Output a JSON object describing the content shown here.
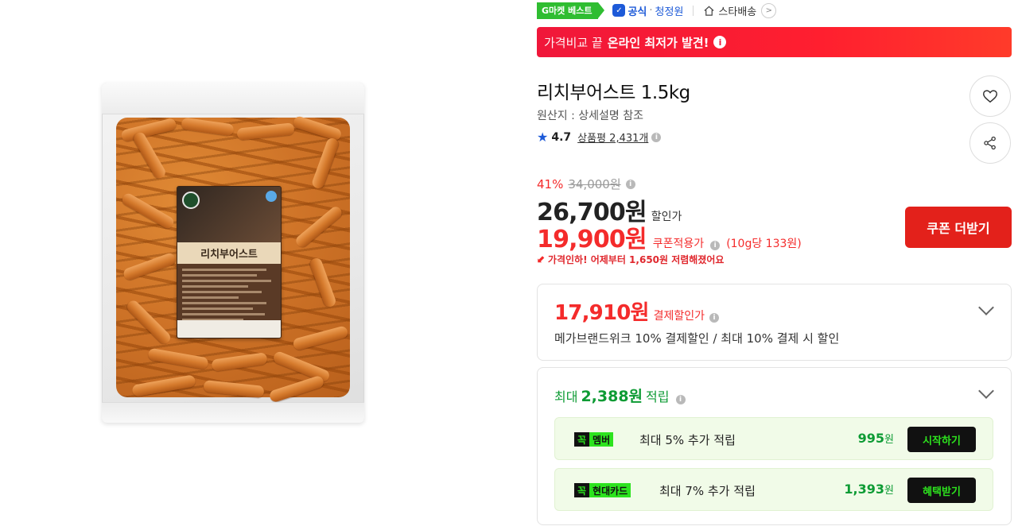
{
  "badges": {
    "gmarket_best": "G마켓 베스트",
    "official": "공식",
    "official_store": "청정원",
    "delivery": "스타배송"
  },
  "promo": {
    "light": "가격비교 끝",
    "strong": "온라인 최저가 발견!",
    "info": "i"
  },
  "product": {
    "title": "리치부어스트 1.5kg",
    "origin": "원산지 : 상세설명 참조",
    "rating": "4.7",
    "review_label": "상품평 2,431개",
    "package_label": "리치부어스트"
  },
  "price": {
    "discount_rate": "41%",
    "original_price": "34,000원",
    "sale_price": "26,700원",
    "sale_label": "할인가",
    "coupon_price": "19,900원",
    "coupon_label": "쿠폰적용가",
    "unit_price": "(10g당 133원)",
    "price_drop_note": "가격인하! 어제부터 1,650원 저렴해졌어요",
    "coupon_button": "쿠폰 더받기"
  },
  "payment": {
    "price": "17,910원",
    "label": "결제할인가",
    "description": "메가브랜드위크 10% 결제할인 / 최대 10% 결제 시 할인"
  },
  "reward": {
    "prefix": "최대",
    "amount": "2,388원",
    "suffix": "적립",
    "items": [
      {
        "tag_dark": "꼭",
        "tag_green": "멤버",
        "text": "최대 5% 추가 적립",
        "value": "995",
        "unit": "원",
        "button": "시작하기"
      },
      {
        "tag_dark": "꼭",
        "tag_green": "현대카드",
        "text": "최대 7% 추가 적립",
        "value": "1,393",
        "unit": "원",
        "button": "혜택받기"
      }
    ]
  },
  "colors": {
    "accent_red": "#f42b2b",
    "promo_red": "#f0173a",
    "official_blue": "#1d5ad8",
    "reward_green": "#0d9b34",
    "badge_green": "#2fbd31"
  },
  "icons": [
    "heart-icon",
    "share-icon",
    "star-icon",
    "home-icon",
    "chevron-right-icon",
    "chevron-down-icon",
    "info-icon",
    "price-drop-icon"
  ]
}
